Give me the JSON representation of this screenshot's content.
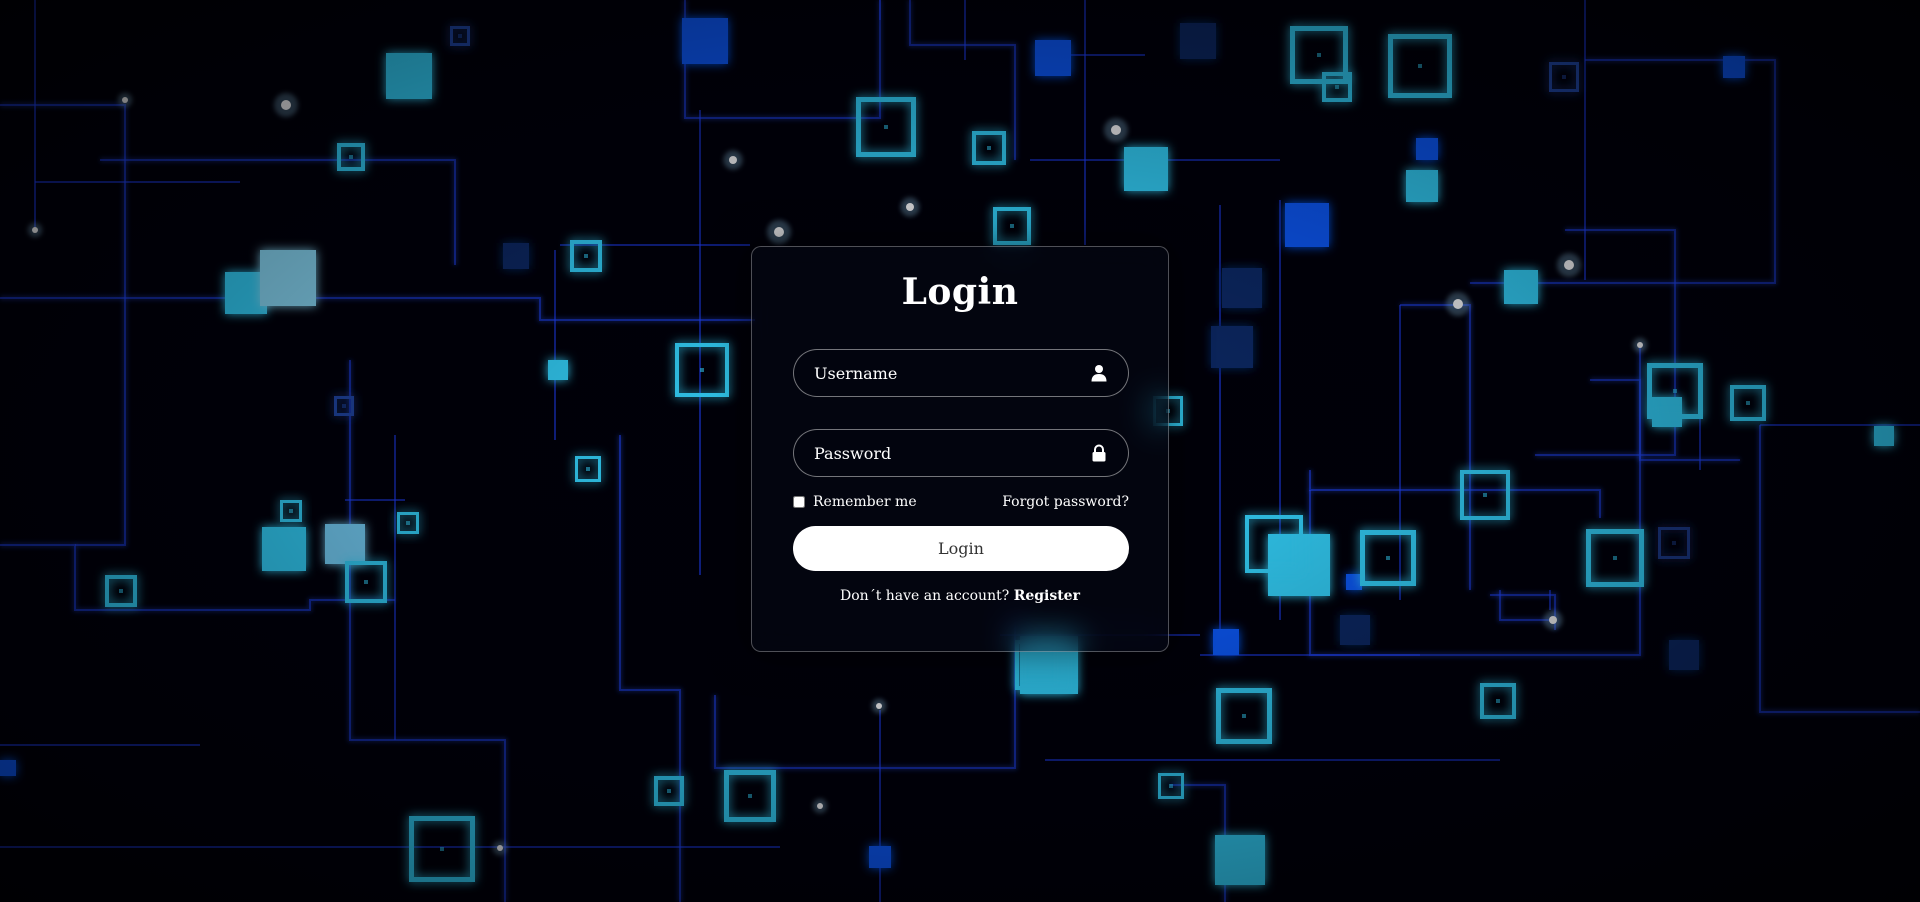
{
  "login": {
    "title": "Login",
    "username": {
      "placeholder": "Username",
      "value": "",
      "icon": "user-icon"
    },
    "password": {
      "placeholder": "Password",
      "value": "",
      "icon": "lock-icon"
    },
    "remember_label": "Remember me",
    "remember_checked": false,
    "forgot_label": "Forgot password?",
    "submit_label": "Login",
    "register_prompt": "Don´t have an account?",
    "register_link": "Register"
  },
  "theme": {
    "background": "#000008",
    "accent_blue": "#0a5cff",
    "accent_cyan": "#35d7ff",
    "button_bg": "#ffffff",
    "button_text": "#333333"
  }
}
